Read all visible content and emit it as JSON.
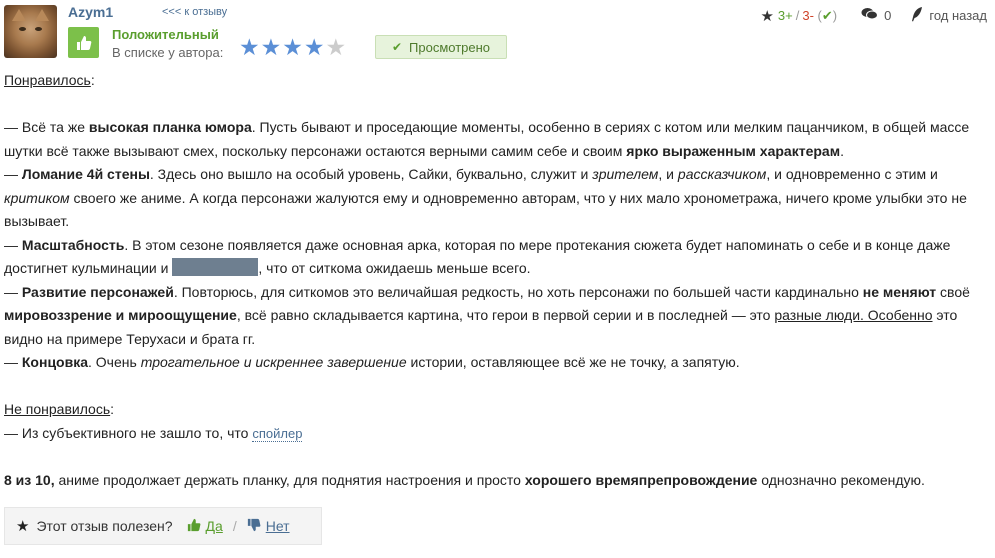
{
  "review": {
    "username": "Azym1",
    "back_link": "<<< к отзыву",
    "verdict": "Положительный",
    "list_label": "В списке у автора:",
    "rating": 4,
    "rating_max": 5,
    "seen_label": "Просмотрено",
    "votes_plus": "3+",
    "votes_sep": "/",
    "votes_minus": "3-",
    "comments_count": "0",
    "posted": "год назад"
  },
  "content": {
    "liked_heading": "Понравилось",
    "liked_colon": ":",
    "p1": {
      "a": "— Всё та же ",
      "b": "высокая планка юмора",
      "c": ". Пусть бывают и проседающие моменты, особенно в сериях с котом или мелким пацанчиком, в общей массе шутки всё также вызывают смех, поскольку персонажи остаются верными самим себе и своим ",
      "d": "ярко выраженным характерам",
      "e": "."
    },
    "p2": {
      "a": "— ",
      "b": "Ломание 4й стены",
      "c": ". Здесь оно вышло на особый уровень, Сайки, буквально, служит и ",
      "d": "зрителем",
      "e": ", и ",
      "f": "рассказчиком",
      "g": ", и одновременно с этим и ",
      "h": "критиком",
      "i": " своего же аниме. А когда персонажи жалуются ему и одновременно авторам, что у них мало хронометража, ничего кроме улыбки это не вызывает."
    },
    "p3": {
      "a": "— ",
      "b": "Масштабность",
      "c": ". В этом сезоне появляется даже основная арка, которая по мере протекания сюжета будет напоминать о себе и в конце даже достигнет кульминации и ",
      "d": ", что от ситкома ожидаешь меньше всего."
    },
    "p4": {
      "a": "— ",
      "b": "Развитие персонажей",
      "c": ". Повторюсь, для ситкомов это величайшая редкость, но хоть персонажи по большей части кардинально ",
      "d": "не меняют",
      "e": " своё ",
      "f": "мировоззрение и мироощущение",
      "g": ", всё равно складывается картина, что герои в первой серии и в последней — это ",
      "h": "разные люди",
      "i": ". Особенно",
      "j": " это видно на примере Терухаси и брата гг."
    },
    "p5": {
      "a": "— ",
      "b": "Концовка",
      "c": ". Очень ",
      "d": "трогательное и искреннее завершение",
      "e": " истории, оставляющее всё же не точку, а запятую."
    },
    "disliked_heading": "Не понравилось",
    "disliked_colon": ":",
    "p6": {
      "a": "— Из субъективного не зашло то, что ",
      "spoiler": "спойлер"
    },
    "p7": {
      "a": "8 из 10,",
      "b": " аниме продолжает держать планку, для поднятия настроения и просто ",
      "c": "хорошего времяпрепровождение",
      "d": " однозначно рекомендую."
    }
  },
  "footer": {
    "question": "Этот отзыв полезен?",
    "yes": "Да",
    "no": "Нет"
  },
  "colors": {
    "link": "#4a6e93",
    "positive": "#5a9e2e",
    "negative": "#d0442a",
    "star_filled": "#5b8fd6",
    "star_empty": "#cccccc"
  },
  "icons": [
    "avatar",
    "thumbs-up-icon",
    "star-icon",
    "check-icon",
    "comment-icon",
    "quill-icon",
    "thumbs-down-icon"
  ]
}
